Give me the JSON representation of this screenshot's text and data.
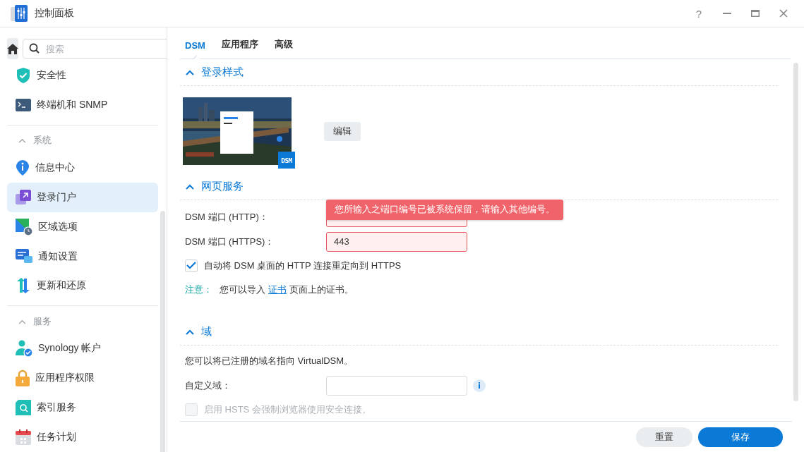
{
  "window": {
    "title": "控制面板",
    "help": "?"
  },
  "sidebar": {
    "search": {
      "placeholder": "搜索"
    },
    "sections": [
      {
        "items": [
          {
            "label": "安全性",
            "selected": false
          },
          {
            "label": "终端机和 SNMP",
            "selected": false
          }
        ]
      },
      {
        "heading": "系统",
        "expanded": true,
        "items": [
          {
            "label": "信息中心",
            "selected": false
          },
          {
            "label": "登录门户",
            "selected": true
          },
          {
            "label": "区域选项",
            "selected": false
          },
          {
            "label": "通知设置",
            "selected": false
          },
          {
            "label": "更新和还原",
            "selected": false
          }
        ]
      },
      {
        "heading": "服务",
        "expanded": true,
        "items": [
          {
            "label": "Synology 帐户",
            "selected": false
          },
          {
            "label": "应用程序权限",
            "selected": false
          },
          {
            "label": "索引服务",
            "selected": false
          },
          {
            "label": "任务计划",
            "selected": false
          }
        ]
      }
    ]
  },
  "tabs": [
    {
      "label": "DSM",
      "selected": true
    },
    {
      "label": "应用程序",
      "selected": false
    },
    {
      "label": "高级",
      "selected": false
    }
  ],
  "login_style": {
    "title": "登录样式",
    "expanded": true,
    "preview": {
      "kind": "picture",
      "badge": "DSM"
    },
    "edit_button": "编辑"
  },
  "web_services": {
    "title": "网页服务",
    "expanded": true,
    "fields": [
      {
        "label": "DSM 端口 (HTTP)：",
        "error": true,
        "tooltip": "您所输入之端口编号已被系统保留，请输入其他编号。"
      },
      {
        "label": "DSM 端口 (HTTPS)：",
        "value": "443",
        "error": true
      }
    ],
    "redirect": {
      "label": "自动将 DSM 桌面的 HTTP 连接重定向到 HTTPS",
      "checked": true,
      "disabled": false
    },
    "note": {
      "label": "注意：",
      "before": "您可以导入",
      "link": "证书",
      "after": "页面上的证书。"
    }
  },
  "domain": {
    "title": "域",
    "expanded": true,
    "description": "您可以将已注册的域名指向 VirtualDSM。",
    "field": {
      "label": "自定义域："
    },
    "hsts": {
      "label": "启用 HSTS 会强制浏览器使用安全连接。",
      "checked": false,
      "disabled": true
    }
  },
  "footer": {
    "buttons": [
      {
        "label": "重置",
        "kind": "secondary"
      },
      {
        "label": "保存",
        "kind": "primary"
      }
    ]
  }
}
